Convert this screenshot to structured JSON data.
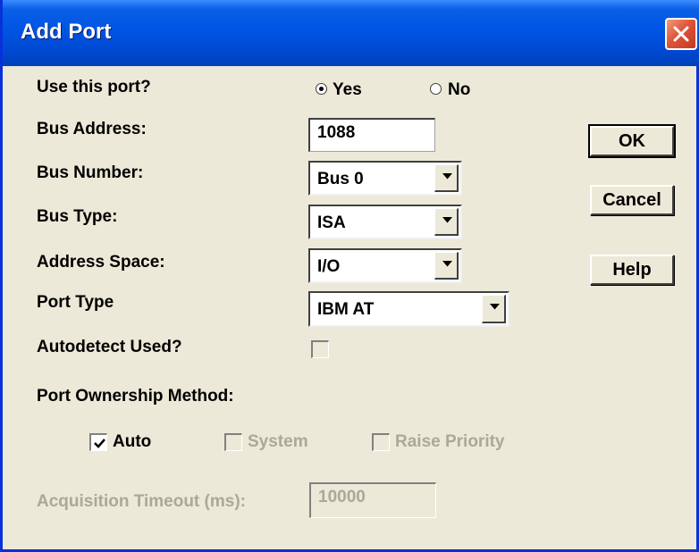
{
  "window": {
    "title": "Add Port"
  },
  "fields": {
    "use_port": {
      "label": "Use this port?",
      "yes": "Yes",
      "no": "No",
      "selected": "Yes"
    },
    "bus_address": {
      "label": "Bus Address:",
      "value": "1088"
    },
    "bus_number": {
      "label": "Bus Number:",
      "value": "Bus 0"
    },
    "bus_type": {
      "label": "Bus Type:",
      "value": "ISA"
    },
    "address_space": {
      "label": "Address Space:",
      "value": "I/O"
    },
    "port_type": {
      "label": "Port Type",
      "value": "IBM AT"
    },
    "autodetect": {
      "label": "Autodetect Used?",
      "checked": false
    }
  },
  "ownership": {
    "label": "Port Ownership Method:",
    "auto": {
      "label": "Auto",
      "checked": true
    },
    "system": {
      "label": "System",
      "checked": false
    },
    "raise_priority": {
      "label": "Raise Priority",
      "checked": false
    }
  },
  "timeout": {
    "label": "Acquisition Timeout (ms):",
    "value": "10000"
  },
  "buttons": {
    "ok": "OK",
    "cancel": "Cancel",
    "help": "Help"
  },
  "colors": {
    "titlebar": "#0054e3",
    "face": "#ece9d8",
    "disabled_text": "#aca899",
    "close": "#e0553a"
  }
}
